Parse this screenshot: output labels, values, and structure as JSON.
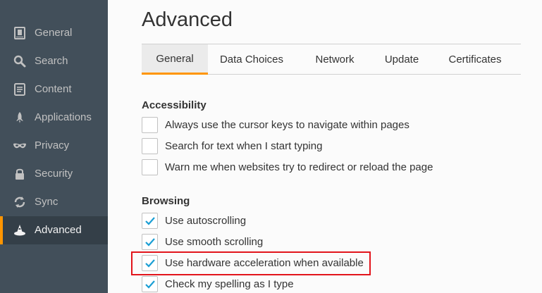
{
  "sidebar": {
    "items": [
      {
        "label": "General",
        "icon": "general-icon"
      },
      {
        "label": "Search",
        "icon": "search-icon"
      },
      {
        "label": "Content",
        "icon": "content-icon"
      },
      {
        "label": "Applications",
        "icon": "applications-icon"
      },
      {
        "label": "Privacy",
        "icon": "privacy-mask-icon"
      },
      {
        "label": "Security",
        "icon": "security-lock-icon"
      },
      {
        "label": "Sync",
        "icon": "sync-icon"
      },
      {
        "label": "Advanced",
        "icon": "advanced-wizard-hat-icon",
        "active": true
      }
    ]
  },
  "page_title": "Advanced",
  "tabs": [
    {
      "label": "General",
      "active": true
    },
    {
      "label": "Data Choices"
    },
    {
      "label": "Network"
    },
    {
      "label": "Update"
    },
    {
      "label": "Certificates"
    }
  ],
  "accessibility": {
    "heading": "Accessibility",
    "options": [
      {
        "label": "Always use the cursor keys to navigate within pages",
        "checked": false
      },
      {
        "label": "Search for text when I start typing",
        "checked": false
      },
      {
        "label": "Warn me when websites try to redirect or reload the page",
        "checked": false
      }
    ]
  },
  "browsing": {
    "heading": "Browsing",
    "options": [
      {
        "label": "Use autoscrolling",
        "checked": true
      },
      {
        "label": "Use smooth scrolling",
        "checked": true
      },
      {
        "label": "Use hardware acceleration when available",
        "checked": true
      },
      {
        "label": "Check my spelling as I type",
        "checked": true
      }
    ]
  },
  "colors": {
    "accent": "#ff9500",
    "sidebar_bg": "#424f5a",
    "highlight": "#e2141b",
    "check": "#1a9ed4"
  }
}
